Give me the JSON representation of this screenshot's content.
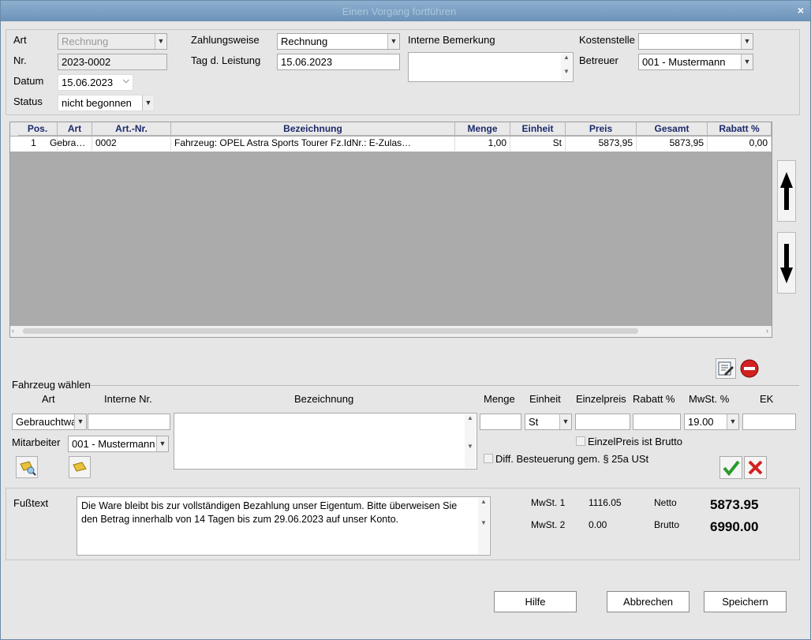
{
  "window": {
    "title": "Einen Vorgang fortführen",
    "close": "×"
  },
  "header": {
    "art_label": "Art",
    "art_value": "Rechnung",
    "nr_label": "Nr.",
    "nr_value": "2023-0002",
    "datum_label": "Datum",
    "datum_value": "15.06.2023",
    "status_label": "Status",
    "status_value": "nicht begonnen",
    "zahlungsweise_label": "Zahlungsweise",
    "zahlungsweise_value": "Rechnung",
    "leistung_label": "Tag d. Leistung",
    "leistung_value": "15.06.2023",
    "bemerkung_label": "Interne Bemerkung",
    "bemerkung_value": "",
    "kostenstelle_label": "Kostenstelle",
    "kostenstelle_value": "",
    "betreuer_label": "Betreuer",
    "betreuer_value": "001 - Mustermann"
  },
  "grid": {
    "columns": [
      "Pos.",
      "Art",
      "Art.-Nr.",
      "Bezeichnung",
      "Menge",
      "Einheit",
      "Preis",
      "Gesamt",
      "Rabatt %"
    ],
    "rows": [
      {
        "pos": "1",
        "art": "Gebra…",
        "artnr": "0002",
        "bez": "Fahrzeug:   OPEL Astra Sports Tourer  Fz.IdNr.:   E-Zulas…",
        "menge": "1,00",
        "einheit": "St",
        "preis": "5873,95",
        "gesamt": "5873,95",
        "rabatt": "0,00"
      }
    ]
  },
  "item": {
    "section_title": "Fahrzeug wählen",
    "art_label": "Art",
    "interne_nr_label": "Interne Nr.",
    "bezeichnung_label": "Bezeichnung",
    "menge_label": "Menge",
    "einheit_label": "Einheit",
    "einzelpreis_label": "Einzelpreis",
    "rabatt_label": "Rabatt %",
    "mwst_label": "MwSt. %",
    "ek_label": "EK",
    "art_value": "Gebrauchtwa",
    "interne_nr_value": "",
    "menge_value": "",
    "einheit_value": "St",
    "einzelpreis_value": "",
    "rabatt_value": "",
    "mwst_value": "19.00",
    "ek_value": "",
    "mitarbeiter_label": "Mitarbeiter",
    "mitarbeiter_value": "001 - Mustermann",
    "brutto_check_label": "EinzelPreis ist Brutto",
    "diff_check_label": "Diff. Besteuerung gem. § 25a USt"
  },
  "footer": {
    "fusstext_label": "Fußtext",
    "fusstext_value": "Die Ware bleibt bis zur vollständigen Bezahlung unser Eigentum. Bitte überweisen Sie den Betrag innerhalb von 14 Tagen bis zum 29.06.2023 auf unser Konto.",
    "mwst1_label": "MwSt. 1",
    "mwst1_value": "1116.05",
    "mwst2_label": "MwSt. 2",
    "mwst2_value": "0.00",
    "netto_label": "Netto",
    "netto_value": "5873.95",
    "brutto_label": "Brutto",
    "brutto_value": "6990.00"
  },
  "buttons": {
    "hilfe": "Hilfe",
    "abbrechen": "Abbrechen",
    "speichern": "Speichern"
  }
}
